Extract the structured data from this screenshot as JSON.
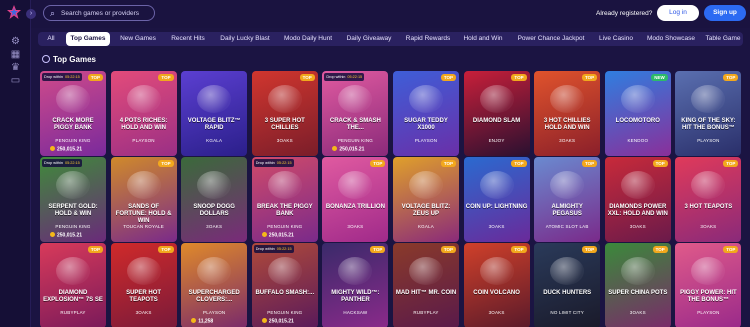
{
  "header": {
    "search_placeholder": "Search games or providers",
    "already_registered": "Already registered?",
    "login_label": "Log in",
    "signup_label": "Sign up"
  },
  "tabs": [
    {
      "label": "All",
      "active": false
    },
    {
      "label": "Top Games",
      "active": true
    },
    {
      "label": "New Games",
      "active": false
    },
    {
      "label": "Recent Hits",
      "active": false
    },
    {
      "label": "Daily Lucky Blast",
      "active": false
    },
    {
      "label": "Modo Daily Hunt",
      "active": false
    },
    {
      "label": "Daily Giveaway",
      "active": false
    },
    {
      "label": "Rapid Rewards",
      "active": false
    },
    {
      "label": "Hold and Win",
      "active": false
    },
    {
      "label": "Power Chance Jackpot",
      "active": false
    },
    {
      "label": "Live Casino",
      "active": false
    },
    {
      "label": "Modo Showcase",
      "active": false
    },
    {
      "label": "Table Game",
      "active": false
    }
  ],
  "section": {
    "title": "Top Games"
  },
  "rail_icons": [
    "gear-icon",
    "slots-icon",
    "trophy-icon",
    "lobby-icon"
  ],
  "games": [
    {
      "name": "Crack More Piggy Bank",
      "provider": "PENGUIN KING",
      "badge": "TOP",
      "drop": "Drop within",
      "timer": "05:22:15",
      "jackpot": "250,015.21",
      "color1": "#cf4a8a",
      "color2": "#7a2a9c"
    },
    {
      "name": "4 Pots Riches: Hold and Win",
      "provider": "PLAYSON",
      "badge": "TOP",
      "drop": "",
      "timer": "",
      "jackpot": "",
      "color1": "#e34b7a",
      "color2": "#9a2f85"
    },
    {
      "name": "Voltage Blitz™ Rapid",
      "provider": "KGALA",
      "badge": "",
      "drop": "",
      "timer": "",
      "jackpot": "",
      "color1": "#5b3fd1",
      "color2": "#2b1f8a"
    },
    {
      "name": "3 Super Hot Chillies",
      "provider": "3OAKS",
      "badge": "TOP",
      "drop": "",
      "timer": "",
      "jackpot": "",
      "color1": "#d1362e",
      "color2": "#7a1d2a"
    },
    {
      "name": "Crack & Smash the...",
      "provider": "PENGUIN KING",
      "badge": "",
      "drop": "Drop within",
      "timer": "05:22:15",
      "jackpot": "250,015.21",
      "color1": "#e05aa0",
      "color2": "#8a2a7a"
    },
    {
      "name": "Sugar Teddy X1000",
      "provider": "PLAYSON",
      "badge": "TOP",
      "drop": "",
      "timer": "",
      "jackpot": "",
      "color1": "#3e5ed8",
      "color2": "#6a2fa8"
    },
    {
      "name": "Diamond Slam",
      "provider": "ENJOY",
      "badge": "TOP",
      "drop": "",
      "timer": "",
      "jackpot": "",
      "color1": "#c81f3a",
      "color2": "#2a1030"
    },
    {
      "name": "3 Hot Chillies Hold and Win",
      "provider": "3OAKS",
      "badge": "TOP",
      "drop": "",
      "timer": "",
      "jackpot": "",
      "color1": "#e0532c",
      "color2": "#8a1f2a"
    },
    {
      "name": "Locomotoro",
      "provider": "KENDOO",
      "badge": "NEW",
      "drop": "",
      "timer": "",
      "jackpot": "",
      "color1": "#2f7ee0",
      "color2": "#8a2f9a"
    },
    {
      "name": "King of the Sky: Hit the Bonus™",
      "provider": "PLAYSON",
      "badge": "TOP",
      "drop": "",
      "timer": "",
      "jackpot": "",
      "color1": "#5a6fb0",
      "color2": "#2a2f6a"
    },
    {
      "name": "Serpent Gold: Hold & Win",
      "provider": "PENGUIN KING",
      "badge": "",
      "drop": "Drop within",
      "timer": "05:22:15",
      "jackpot": "250,015.21",
      "color1": "#3f8a3a",
      "color2": "#6a2a7a"
    },
    {
      "name": "Sands of Fortune: Hold & Win",
      "provider": "TOUCAN ROYALE",
      "badge": "TOP",
      "drop": "",
      "timer": "",
      "jackpot": "",
      "color1": "#d08a2a",
      "color2": "#7a2a8a"
    },
    {
      "name": "Snoop Dogg Dollars",
      "provider": "3OAKS",
      "badge": "",
      "drop": "",
      "timer": "",
      "jackpot": "",
      "color1": "#3a6a3a",
      "color2": "#7a2a7a"
    },
    {
      "name": "Break the Piggy Bank",
      "provider": "PENGUIN KING",
      "badge": "",
      "drop": "Drop within",
      "timer": "05:22:15",
      "jackpot": "250,015.21",
      "color1": "#d04a6a",
      "color2": "#7a2a8a"
    },
    {
      "name": "Bonanza Trillion",
      "provider": "3OAKS",
      "badge": "TOP",
      "drop": "",
      "timer": "",
      "jackpot": "",
      "color1": "#e05aa0",
      "color2": "#a02a8a"
    },
    {
      "name": "Voltage Blitz: Zeus Up",
      "provider": "KGALA",
      "badge": "TOP",
      "drop": "",
      "timer": "",
      "jackpot": "",
      "color1": "#e0a02a",
      "color2": "#8a2a7a"
    },
    {
      "name": "Coin Up: Lightning",
      "provider": "3OAKS",
      "badge": "TOP",
      "drop": "",
      "timer": "",
      "jackpot": "",
      "color1": "#2a6ad0",
      "color2": "#6a2a9a"
    },
    {
      "name": "Almighty Pegasus",
      "provider": "ATOMIC SLOT LAB",
      "badge": "TOP",
      "drop": "",
      "timer": "",
      "jackpot": "",
      "color1": "#6a8ad0",
      "color2": "#7a2a8a"
    },
    {
      "name": "Diamonds Power XXL: Hold and Win",
      "provider": "3OAKS",
      "badge": "TOP",
      "drop": "",
      "timer": "",
      "jackpot": "",
      "color1": "#c82a3a",
      "color2": "#6a1a4a"
    },
    {
      "name": "3 Hot Teapots",
      "provider": "3OAKS",
      "badge": "TOP",
      "drop": "",
      "timer": "",
      "jackpot": "",
      "color1": "#e03a5a",
      "color2": "#8a2a7a"
    },
    {
      "name": "Diamond Explosion™ 7s SE",
      "provider": "RUBYPLAY",
      "badge": "TOP",
      "drop": "",
      "timer": "",
      "jackpot": "",
      "color1": "#d83a5a",
      "color2": "#7a1a5a"
    },
    {
      "name": "Super Hot Teapots",
      "provider": "3OAKS",
      "badge": "TOP",
      "drop": "",
      "timer": "",
      "jackpot": "",
      "color1": "#d02a2a",
      "color2": "#7a1a3a"
    },
    {
      "name": "Supercharged Clovers:...",
      "provider": "PLAYSON",
      "badge": "",
      "drop": "",
      "timer": "",
      "jackpot": "11,258",
      "color1": "#e08a2a",
      "color2": "#7a2a6a"
    },
    {
      "name": "Buffalo Smash:...",
      "provider": "PENGUIN KING",
      "badge": "",
      "drop": "Drop within",
      "timer": "05:22:15",
      "jackpot": "250,015.21",
      "color1": "#b04a3a",
      "color2": "#5a1a5a"
    },
    {
      "name": "Mighty Wild™: Panther",
      "provider": "HACKSAW",
      "badge": "TOP",
      "drop": "",
      "timer": "",
      "jackpot": "",
      "color1": "#3a2a6a",
      "color2": "#8a2a8a"
    },
    {
      "name": "Mad Hit™ Mr. Coin",
      "provider": "RUBYPLAY",
      "badge": "TOP",
      "drop": "",
      "timer": "",
      "jackpot": "",
      "color1": "#8a3a2a",
      "color2": "#5a1a4a"
    },
    {
      "name": "Coin Volcano",
      "provider": "3OAKS",
      "badge": "TOP",
      "drop": "",
      "timer": "",
      "jackpot": "",
      "color1": "#d0402a",
      "color2": "#5a1a2a"
    },
    {
      "name": "Duck Hunters",
      "provider": "NO LIMIT CITY",
      "badge": "TOP",
      "drop": "",
      "timer": "",
      "jackpot": "",
      "color1": "#2a3a5a",
      "color2": "#1a1a2a"
    },
    {
      "name": "Super China Pots",
      "provider": "3OAKS",
      "badge": "TOP",
      "drop": "",
      "timer": "",
      "jackpot": "",
      "color1": "#3a8a3a",
      "color2": "#7a2a6a"
    },
    {
      "name": "Piggy Power: Hit the Bonus™",
      "provider": "PLAYSON",
      "badge": "TOP",
      "drop": "",
      "timer": "",
      "jackpot": "",
      "color1": "#e05a8a",
      "color2": "#9a2a8a"
    }
  ]
}
